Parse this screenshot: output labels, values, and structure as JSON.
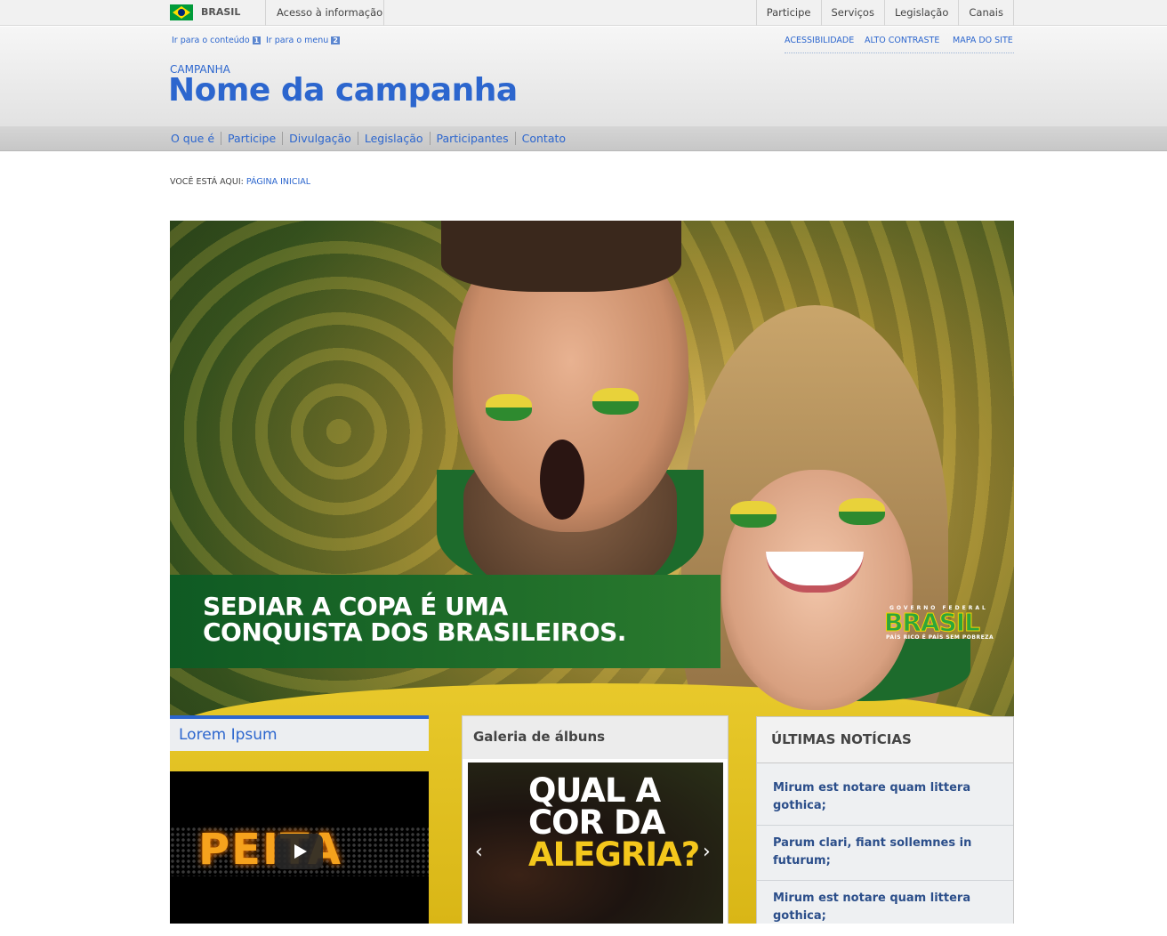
{
  "govbar": {
    "brasil": "BRASIL",
    "acesso": "Acesso à informação",
    "links": [
      "Participe",
      "Serviços",
      "Legislação",
      "Canais"
    ]
  },
  "header": {
    "skip_content": "Ir para o conteúdo",
    "skip_content_num": "1",
    "skip_menu": "Ir para o menu",
    "skip_menu_num": "2",
    "acessibilidade": "ACESSIBILIDADE",
    "alto_contraste": "ALTO CONTRASTE",
    "mapa": "MAPA DO SITE",
    "campanha": "CAMPANHA",
    "nome": "Nome da campanha"
  },
  "menu": [
    "O que é",
    "Participe",
    "Divulgação",
    "Legislação",
    "Participantes",
    "Contato"
  ],
  "breadcrumb": {
    "label": "VOCÊ ESTÁ AQUI:",
    "current": "PÁGINA INICIAL"
  },
  "hero": {
    "line1": "SEDIAR A COPA É UMA",
    "line2": "CONQUISTA DOS BRASILEIROS.",
    "logo_top": "GOVERNO FEDERAL",
    "logo_main": "BRASIL",
    "logo_bottom": "PAÍS RICO É PAÍS SEM POBREZA"
  },
  "lorem": {
    "title": "Lorem Ipsum",
    "video_word": "PEITA"
  },
  "galeria": {
    "title": "Galeria de álbuns",
    "line1": "QUAL A",
    "line2": "COR DA",
    "line3": "ALEGRIA?"
  },
  "noticias": {
    "title": "ÚLTIMAS NOTÍCIAS",
    "items": [
      "Mirum est notare quam littera gothica;",
      "Parum clari, fiant sollemnes in futurum;",
      "Mirum est notare quam littera gothica;"
    ]
  },
  "colors": {
    "link_blue": "#2c66ce",
    "banner_green": "#0f5a23",
    "flag_yellow": "#fedf00"
  }
}
